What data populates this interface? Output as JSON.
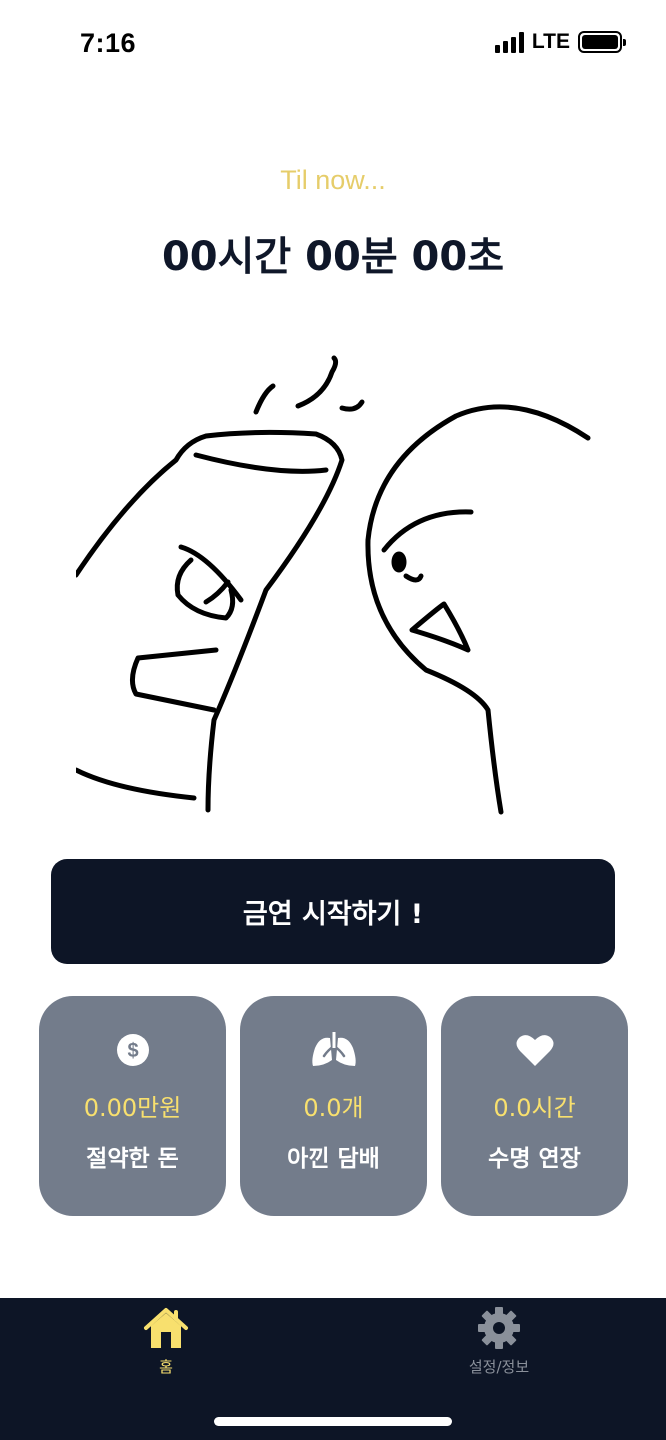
{
  "status_bar": {
    "time": "7:16",
    "network": "LTE"
  },
  "hero": {
    "subtitle": "Til now...",
    "timer": "00시간 00분 00초"
  },
  "start_button": {
    "label": "금연 시작하기 !"
  },
  "stats": [
    {
      "icon": "dollar-icon",
      "value": "0.00만원",
      "label": "절약한 돈"
    },
    {
      "icon": "lungs-icon",
      "value": "0.0개",
      "label": "아낀 담배"
    },
    {
      "icon": "heart-icon",
      "value": "0.0시간",
      "label": "수명 연장"
    }
  ],
  "tab_bar": {
    "tabs": [
      {
        "icon": "home-icon",
        "label": "홈",
        "active": true
      },
      {
        "icon": "gear-icon",
        "label": "설정/정보",
        "active": false
      }
    ]
  },
  "colors": {
    "navy": "#0d1526",
    "accent_yellow": "#f8e06e",
    "subtitle_yellow": "#e6cd6a",
    "card_gray": "#737c8b",
    "inactive_gray": "#8a909a"
  }
}
